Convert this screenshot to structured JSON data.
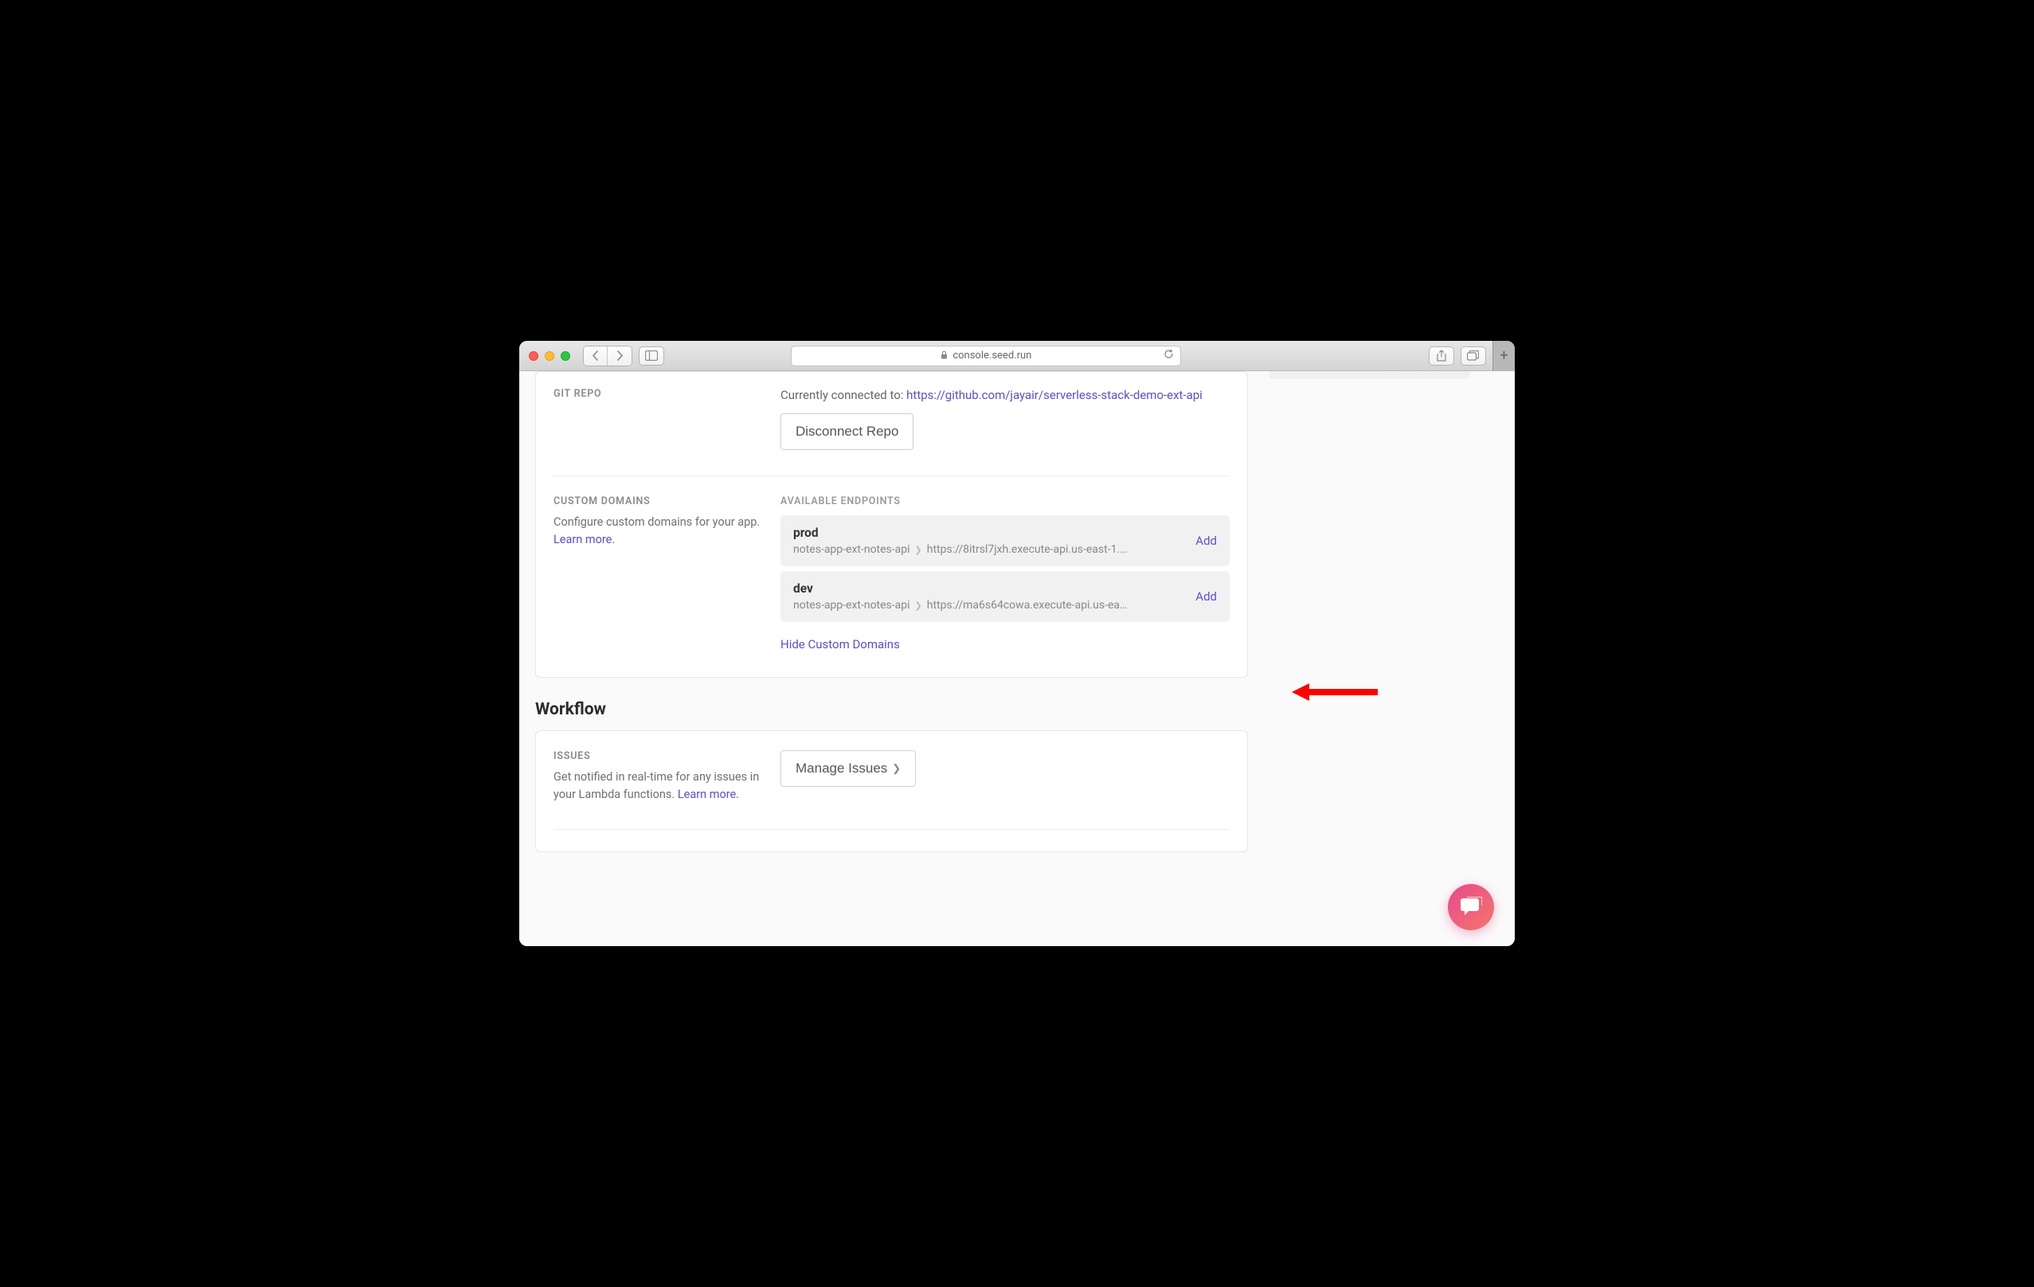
{
  "browser": {
    "url": "console.seed.run"
  },
  "git_repo": {
    "heading": "GIT REPO",
    "connected_prefix": "Currently connected to: ",
    "repo_url": "https://github.com/jayair/serverless-stack-demo-ext-api",
    "disconnect_label": "Disconnect Repo"
  },
  "custom_domains": {
    "heading": "CUSTOM DOMAINS",
    "description": "Configure custom domains for your app. ",
    "learn_more": "Learn more.",
    "endpoints_heading": "AVAILABLE ENDPOINTS",
    "hide_label": "Hide Custom Domains",
    "add_label": "Add",
    "endpoints": [
      {
        "name": "prod",
        "stack": "notes-app-ext-notes-api",
        "url": "https://8itrsl7jxh.execute-api.us-east-1.…"
      },
      {
        "name": "dev",
        "stack": "notes-app-ext-notes-api",
        "url": "https://ma6s64cowa.execute-api.us-ea…"
      }
    ]
  },
  "workflow": {
    "heading": "Workflow",
    "issues": {
      "heading": "ISSUES",
      "description": "Get notified in real-time for any issues in your Lambda functions. ",
      "learn_more": "Learn more.",
      "manage_label": "Manage Issues"
    }
  }
}
